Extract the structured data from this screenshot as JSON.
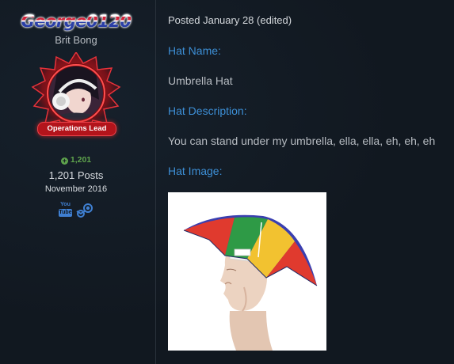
{
  "author": {
    "username": "George0120",
    "title": "Brit Bong",
    "rank_badge": "Operations Lead",
    "reputation": "1,201",
    "posts": "1,201 Posts",
    "joined": "November 2016",
    "social": {
      "youtube_top": "You",
      "youtube_bottom": "Tube",
      "youtube_icon": "youtube-icon",
      "steam_icon": "steam-icon"
    }
  },
  "post": {
    "meta": "Posted January 28 (edited)",
    "hat_name_heading": "Hat Name:",
    "hat_name": "Umbrella Hat",
    "hat_description_heading": "Hat Description:",
    "hat_description": "You can stand under my umbrella, ella, ella, eh, eh, eh",
    "hat_image_heading": "Hat Image:"
  },
  "colors": {
    "background": "#111820",
    "link_heading": "#3d8fd6",
    "reputation_green": "#5fa44d",
    "badge_red": "#b3141b"
  }
}
